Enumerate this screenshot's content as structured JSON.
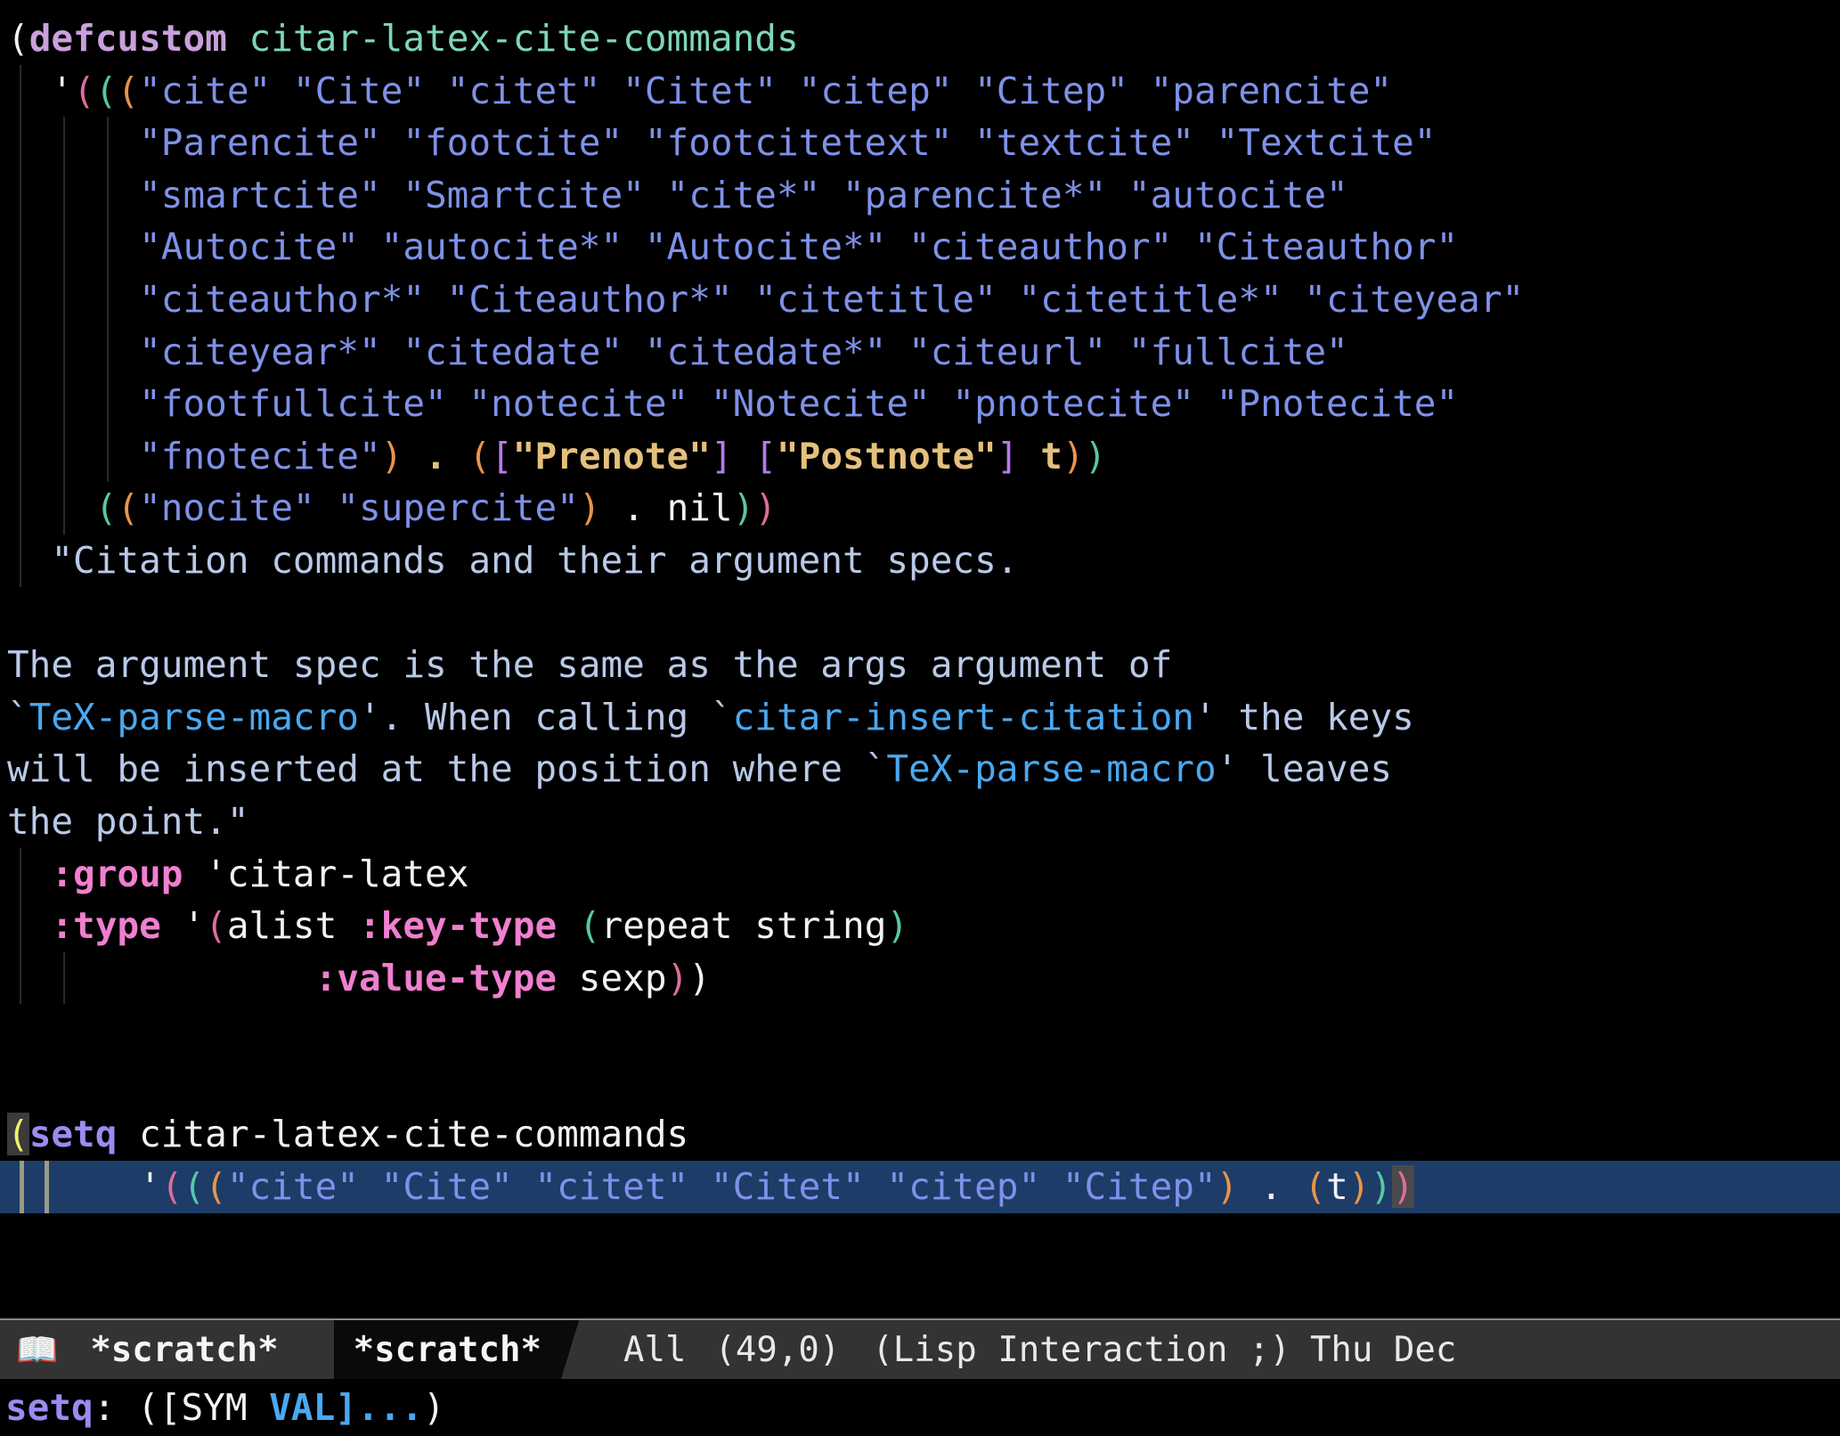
{
  "editor": {
    "app": "emacs",
    "theme": {
      "background": "#000000",
      "foreground": "#f2f2f6",
      "string": "#7f91e8",
      "docstring": "#b9c9e8",
      "doc_reference": "#4aa8f0",
      "keyword": "#c9a0dc",
      "constant_keyword": "#f07fd0",
      "function_name": "#7ed6b8",
      "selection": "#1d3c68",
      "matching_paren": "#f2f068",
      "cursor": "#4a4a4a",
      "paren_depth_1": "#e06c9f",
      "paren_depth_2": "#56c8a8",
      "paren_depth_3": "#e8954a",
      "paren_depth_4": "#b57aee",
      "bracket_tan": "#e5c07b",
      "modeline_bg": "#333333",
      "modeline_dark": "#0a0a0a"
    }
  },
  "buffer": {
    "lines": [
      {
        "id": "l01",
        "segments": [
          {
            "t": "(",
            "c": "plain"
          },
          {
            "t": "defcustom",
            "c": "kw"
          },
          {
            "t": " ",
            "c": "plain"
          },
          {
            "t": "citar-latex-cite-commands",
            "c": "fname"
          }
        ]
      },
      {
        "id": "l02",
        "guides": 1,
        "segments": [
          {
            "t": "  ",
            "c": "plain"
          },
          {
            "t": "'",
            "c": "quote"
          },
          {
            "t": "(",
            "c": "p1"
          },
          {
            "t": "(",
            "c": "p2"
          },
          {
            "t": "(",
            "c": "p3"
          },
          {
            "t": "\"cite\" \"Cite\" \"citet\" \"Citet\" \"citep\" \"Citep\" \"parencite\"",
            "c": "str"
          }
        ]
      },
      {
        "id": "l03",
        "guides": 3,
        "segments": [
          {
            "t": "      ",
            "c": "plain"
          },
          {
            "t": "\"Parencite\" \"footcite\" \"footcitetext\" \"textcite\" \"Textcite\"",
            "c": "str"
          }
        ]
      },
      {
        "id": "l04",
        "guides": 3,
        "segments": [
          {
            "t": "      ",
            "c": "plain"
          },
          {
            "t": "\"smartcite\" \"Smartcite\" \"cite*\" \"parencite*\" \"autocite\"",
            "c": "str"
          }
        ]
      },
      {
        "id": "l05",
        "guides": 3,
        "segments": [
          {
            "t": "      ",
            "c": "plain"
          },
          {
            "t": "\"Autocite\" \"autocite*\" \"Autocite*\" \"citeauthor\" \"Citeauthor\"",
            "c": "str"
          }
        ]
      },
      {
        "id": "l06",
        "guides": 3,
        "segments": [
          {
            "t": "      ",
            "c": "plain"
          },
          {
            "t": "\"citeauthor*\" \"Citeauthor*\" \"citetitle\" \"citetitle*\" \"citeyear\"",
            "c": "str"
          }
        ]
      },
      {
        "id": "l07",
        "guides": 3,
        "segments": [
          {
            "t": "      ",
            "c": "plain"
          },
          {
            "t": "\"citeyear*\" \"citedate\" \"citedate*\" \"citeurl\" \"fullcite\"",
            "c": "str"
          }
        ]
      },
      {
        "id": "l08",
        "guides": 3,
        "segments": [
          {
            "t": "      ",
            "c": "plain"
          },
          {
            "t": "\"footfullcite\" \"notecite\" \"Notecite\" \"pnotecite\" \"Pnotecite\"",
            "c": "str"
          }
        ]
      },
      {
        "id": "l09",
        "guides": 3,
        "segments": [
          {
            "t": "      ",
            "c": "plain"
          },
          {
            "t": "\"fnotecite\"",
            "c": "str"
          },
          {
            "t": ")",
            "c": "p3"
          },
          {
            "t": " ",
            "c": "plain"
          },
          {
            "t": ".",
            "c": "tan"
          },
          {
            "t": " ",
            "c": "plain"
          },
          {
            "t": "(",
            "c": "p3"
          },
          {
            "t": "[",
            "c": "p4"
          },
          {
            "t": "\"Prenote\"",
            "c": "tan"
          },
          {
            "t": "]",
            "c": "p4"
          },
          {
            "t": " ",
            "c": "plain"
          },
          {
            "t": "[",
            "c": "p4"
          },
          {
            "t": "\"Postnote\"",
            "c": "tan"
          },
          {
            "t": "]",
            "c": "p4"
          },
          {
            "t": " ",
            "c": "plain"
          },
          {
            "t": "t",
            "c": "tan"
          },
          {
            "t": ")",
            "c": "p3"
          },
          {
            "t": ")",
            "c": "p2"
          }
        ]
      },
      {
        "id": "l10",
        "guides": 2,
        "segments": [
          {
            "t": "    ",
            "c": "plain"
          },
          {
            "t": "(",
            "c": "p2"
          },
          {
            "t": "(",
            "c": "p3"
          },
          {
            "t": "\"nocite\" \"supercite\"",
            "c": "str"
          },
          {
            "t": ")",
            "c": "p3"
          },
          {
            "t": " . ",
            "c": "plain"
          },
          {
            "t": "nil",
            "c": "plain"
          },
          {
            "t": ")",
            "c": "p2"
          },
          {
            "t": ")",
            "c": "p1"
          }
        ]
      },
      {
        "id": "l11",
        "guides": 1,
        "segments": [
          {
            "t": "  ",
            "c": "plain"
          },
          {
            "t": "\"Citation commands and their argument specs.",
            "c": "doc"
          }
        ]
      },
      {
        "id": "l12",
        "guides": 0,
        "segments": []
      },
      {
        "id": "l13",
        "segments": [
          {
            "t": "The argument spec is the same as the args argument of",
            "c": "doc"
          }
        ]
      },
      {
        "id": "l14",
        "segments": [
          {
            "t": "`",
            "c": "doc"
          },
          {
            "t": "TeX-parse-macro",
            "c": "docref"
          },
          {
            "t": "'. When calling `",
            "c": "doc"
          },
          {
            "t": "citar-insert-citation",
            "c": "docref"
          },
          {
            "t": "' the keys",
            "c": "doc"
          }
        ]
      },
      {
        "id": "l15",
        "segments": [
          {
            "t": "will be inserted at the position where `",
            "c": "doc"
          },
          {
            "t": "TeX-parse-macro",
            "c": "docref"
          },
          {
            "t": "' leaves",
            "c": "doc"
          }
        ]
      },
      {
        "id": "l16",
        "segments": [
          {
            "t": "the point.\"",
            "c": "doc"
          }
        ]
      },
      {
        "id": "l17",
        "guides": 1,
        "segments": [
          {
            "t": "  ",
            "c": "plain"
          },
          {
            "t": ":group",
            "c": "ckw"
          },
          {
            "t": " '",
            "c": "plain"
          },
          {
            "t": "citar-latex",
            "c": "plain"
          }
        ]
      },
      {
        "id": "l18",
        "guides": 1,
        "segments": [
          {
            "t": "  ",
            "c": "plain"
          },
          {
            "t": ":type",
            "c": "ckw"
          },
          {
            "t": " '",
            "c": "plain"
          },
          {
            "t": "(",
            "c": "p1"
          },
          {
            "t": "alist ",
            "c": "plain"
          },
          {
            "t": ":key-type",
            "c": "ckw"
          },
          {
            "t": " ",
            "c": "plain"
          },
          {
            "t": "(",
            "c": "p2"
          },
          {
            "t": "repeat string",
            "c": "plain"
          },
          {
            "t": ")",
            "c": "p2"
          }
        ]
      },
      {
        "id": "l19",
        "guides": 2,
        "segments": [
          {
            "t": "              ",
            "c": "plain"
          },
          {
            "t": ":value-type",
            "c": "ckw"
          },
          {
            "t": " sexp",
            "c": "plain"
          },
          {
            "t": ")",
            "c": "p1"
          },
          {
            "t": ")",
            "c": "plain"
          }
        ]
      },
      {
        "id": "l20",
        "guides": 0,
        "segments": []
      },
      {
        "id": "l21",
        "guides": 0,
        "segments": []
      },
      {
        "id": "l22",
        "match_paren": true,
        "segments": [
          {
            "t": "(",
            "c": "mparen"
          },
          {
            "t": "setq",
            "c": "kw-setq"
          },
          {
            "t": " ",
            "c": "plain"
          },
          {
            "t": "citar-latex-cite-commands",
            "c": "plain"
          }
        ]
      },
      {
        "id": "l23",
        "selected": true,
        "guides_bright": true,
        "cursor_at_end": true,
        "segments": [
          {
            "t": "      ",
            "c": "plain"
          },
          {
            "t": "'",
            "c": "quote"
          },
          {
            "t": "(",
            "c": "p1"
          },
          {
            "t": "(",
            "c": "p2"
          },
          {
            "t": "(",
            "c": "p3"
          },
          {
            "t": "\"cite\" \"Cite\" \"citet\" \"Citet\" \"citep\" \"Citep\"",
            "c": "str"
          },
          {
            "t": ")",
            "c": "p3"
          },
          {
            "t": " . ",
            "c": "plain"
          },
          {
            "t": "(",
            "c": "p3"
          },
          {
            "t": "t",
            "c": "plain"
          },
          {
            "t": ")",
            "c": "p3"
          },
          {
            "t": ")",
            "c": "p2"
          },
          {
            "t": ")",
            "c": "p1"
          }
        ],
        "cursor_char": ")"
      }
    ],
    "raw_text": [
      "(defcustom citar-latex-cite-commands",
      "  '(((\"cite\" \"Cite\" \"citet\" \"Citet\" \"citep\" \"Citep\" \"parencite\"",
      "      \"Parencite\" \"footcite\" \"footcitetext\" \"textcite\" \"Textcite\"",
      "      \"smartcite\" \"Smartcite\" \"cite*\" \"parencite*\" \"autocite\"",
      "      \"Autocite\" \"autocite*\" \"Autocite*\" \"citeauthor\" \"Citeauthor\"",
      "      \"citeauthor*\" \"Citeauthor*\" \"citetitle\" \"citetitle*\" \"citeyear\"",
      "      \"citeyear*\" \"citedate\" \"citedate*\" \"citeurl\" \"fullcite\"",
      "      \"footfullcite\" \"notecite\" \"Notecite\" \"pnotecite\" \"Pnotecite\"",
      "      \"fnotecite\") . ([\"Prenote\"] [\"Postnote\"] t))",
      "    ((\"nocite\" \"supercite\") . nil))",
      "  \"Citation commands and their argument specs.",
      "",
      "The argument spec is the same as the args argument of",
      "`TeX-parse-macro'. When calling `citar-insert-citation' the keys",
      "will be inserted at the position where `TeX-parse-macro' leaves",
      "the point.\"",
      "  :group 'citar-latex",
      "  :type '(alist :key-type (repeat string)",
      "              :value-type sexp))",
      "",
      "",
      "(setq citar-latex-cite-commands",
      "      '(((\"cite\" \"Cite\" \"citet\" \"Citet\" \"citep\" \"Citep\") . (t)))"
    ]
  },
  "modeline": {
    "icon": "open-book",
    "icon_glyph": "📖",
    "buffer_name_left": "*scratch*",
    "buffer_name_right": "*scratch*",
    "scroll_position": "All",
    "point_position": "(49,0)",
    "major_mode": "(Lisp Interaction ;)",
    "clock": "Thu Dec"
  },
  "echo_area": {
    "function": "setq",
    "colon": ": ",
    "signature_open": "([SYM ",
    "signature_highlight": "VAL]...",
    "signature_close": ")"
  }
}
